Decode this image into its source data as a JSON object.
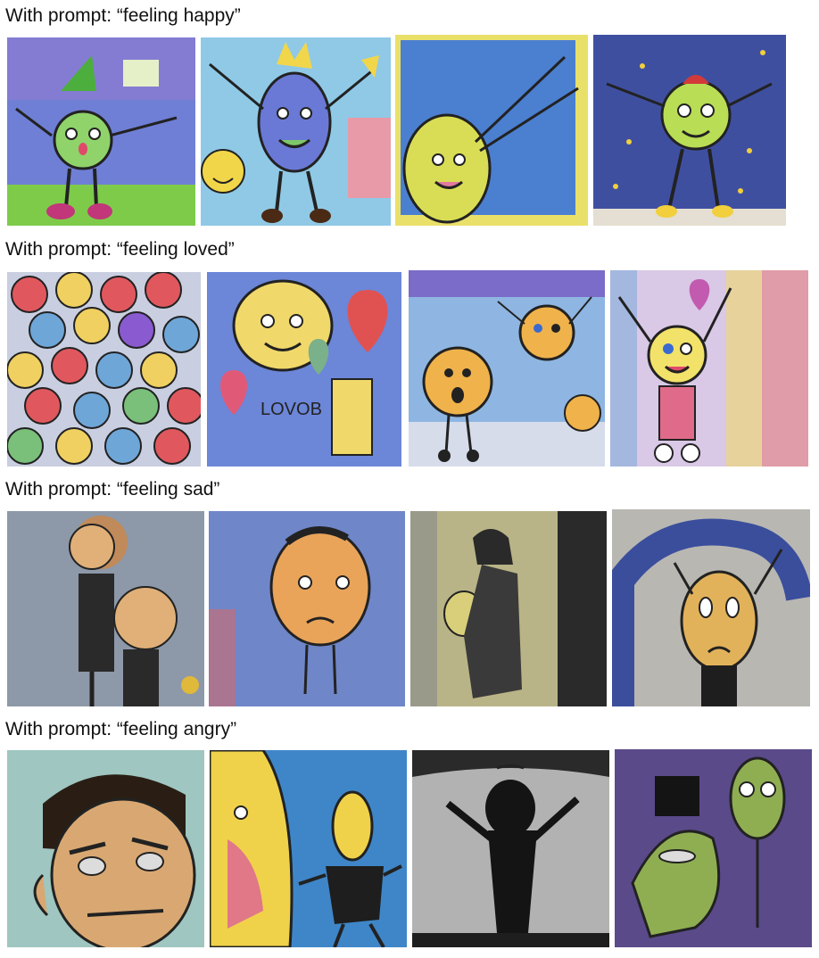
{
  "rows": [
    {
      "label": "With prompt: “feeling happy”",
      "images": [
        {
          "subject": "happy green-faced stick figure with raised arms on purple sky and green grass",
          "colors": {
            "bg": "#6f7fd6",
            "ground": "#7ecb4a",
            "face": "#8fd36a"
          }
        },
        {
          "subject": "smiling blue round figure with crown, small yellow smiley face beside",
          "colors": {
            "bg": "#8fc9e6",
            "face": "#6a79d6",
            "accent": "#f2d64a"
          }
        },
        {
          "subject": "yellow-green lemon-shaped face waving on blue background",
          "colors": {
            "bg": "#4b7fd0",
            "face": "#d9dd55",
            "accent": "#e9e06a"
          }
        },
        {
          "subject": "yellow-green smiling figure with arms up on dark blue night sky with stars",
          "colors": {
            "bg": "#3f4fa0",
            "face": "#b9dd55",
            "accent": "#f2cf3c"
          }
        }
      ]
    },
    {
      "label": "With prompt: “feeling loved”",
      "images": [
        {
          "subject": "many colorful heart-shaped smiling faces",
          "colors": {
            "bg": "#c9cfe0",
            "a": "#e0585e",
            "b": "#f0d060",
            "c": "#6fa6d8"
          }
        },
        {
          "subject": "yellow smiling heart character with hearts and scribbled words",
          "colors": {
            "bg": "#6c86d8",
            "face": "#f0d86a",
            "accent": "#e05252"
          }
        },
        {
          "subject": "two orange round smiling faces with stick arms under blue sky",
          "colors": {
            "bg": "#8fb6e2",
            "face": "#f0b24a",
            "accent": "#d6dcea"
          }
        },
        {
          "subject": "yellow smiling figure with arms up on rainbow pastel background and hearts",
          "colors": {
            "bg": "#d9c8e6",
            "face": "#f2e26a",
            "accent": "#e8706a"
          }
        }
      ]
    },
    {
      "label": "With prompt: “feeling sad”",
      "images": [
        {
          "subject": "grey figure with brown hair and round face, dark clothes",
          "colors": {
            "bg": "#8d98a8",
            "face": "#e0b078",
            "accent": "#2a2a2a"
          }
        },
        {
          "subject": "large orange sad face on blue background",
          "colors": {
            "bg": "#6f86c8",
            "face": "#e9a45a",
            "accent": "#d06a6a"
          }
        },
        {
          "subject": "dark hunched figure in muted yellow and grey tones",
          "colors": {
            "bg": "#b9b487",
            "face": "#3a3a3a",
            "accent": "#9a9a8a"
          }
        },
        {
          "subject": "sad yellow face figure under dark blue arch on grey background",
          "colors": {
            "bg": "#b9b7b2",
            "face": "#e2b25a",
            "accent": "#3a4e9c"
          }
        }
      ]
    },
    {
      "label": "With prompt: “feeling angry”",
      "images": [
        {
          "subject": "angry brown-haired man face with furrowed brows on teal background",
          "colors": {
            "bg": "#9fc6c0",
            "face": "#d9a872",
            "accent": "#2a1e14"
          }
        },
        {
          "subject": "angry yellow faces on bright blue background",
          "colors": {
            "bg": "#3f86c8",
            "face": "#f0d24a",
            "accent": "#e07888"
          }
        },
        {
          "subject": "black shadow figure with raised arms on grey background",
          "colors": {
            "bg": "#b2b2b2",
            "face": "#141414",
            "accent": "#d8d8d8"
          }
        },
        {
          "subject": "green angry figures on dark purple background",
          "colors": {
            "bg": "#5a4a8a",
            "face": "#8fae52",
            "accent": "#141414"
          }
        }
      ]
    }
  ]
}
